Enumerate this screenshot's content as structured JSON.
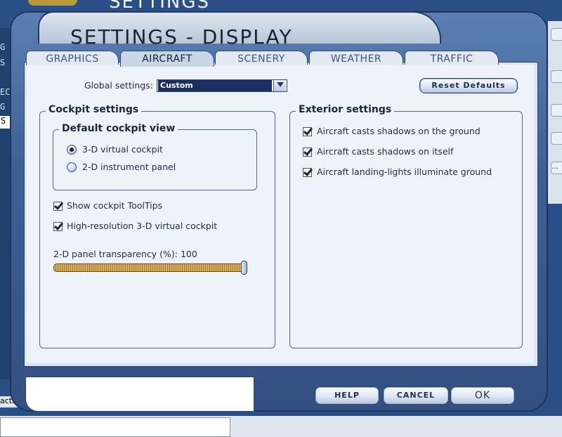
{
  "background": {
    "title": "SETTINGS",
    "left_items": [
      "G",
      "S",
      "EC",
      "G"
    ],
    "left_selected": "S",
    "bottom_stub": "acts",
    "right_stub": "..."
  },
  "dialog": {
    "title": "SETTINGS - DISPLAY",
    "tabs": [
      {
        "label": "GRAPHICS",
        "active": false
      },
      {
        "label": "AIRCRAFT",
        "active": true
      },
      {
        "label": "SCENERY",
        "active": false
      },
      {
        "label": "WEATHER",
        "active": false
      },
      {
        "label": "TRAFFIC",
        "active": false
      }
    ],
    "global_settings": {
      "label": "Global settings:",
      "value": "Custom"
    },
    "reset_defaults_label": "Reset Defaults",
    "cockpit": {
      "title": "Cockpit settings",
      "default_view": {
        "title": "Default cockpit view",
        "options": [
          {
            "label": "3-D virtual cockpit",
            "selected": true
          },
          {
            "label": "2-D instrument panel",
            "selected": false
          }
        ]
      },
      "show_tooltips": {
        "label": "Show cockpit ToolTips",
        "checked": true
      },
      "hires_vc": {
        "label": "High-resolution 3-D virtual cockpit",
        "checked": true
      },
      "transparency": {
        "label": "2-D panel transparency (%): 100",
        "value": 100
      }
    },
    "exterior": {
      "title": "Exterior settings",
      "options": [
        {
          "label": "Aircraft casts shadows on the ground",
          "checked": true
        },
        {
          "label": "Aircraft casts shadows on itself",
          "checked": true
        },
        {
          "label": "Aircraft landing-lights illuminate ground",
          "checked": true
        }
      ]
    },
    "buttons": {
      "help": "HELP",
      "cancel": "CANCEL",
      "ok": "OK"
    }
  }
}
